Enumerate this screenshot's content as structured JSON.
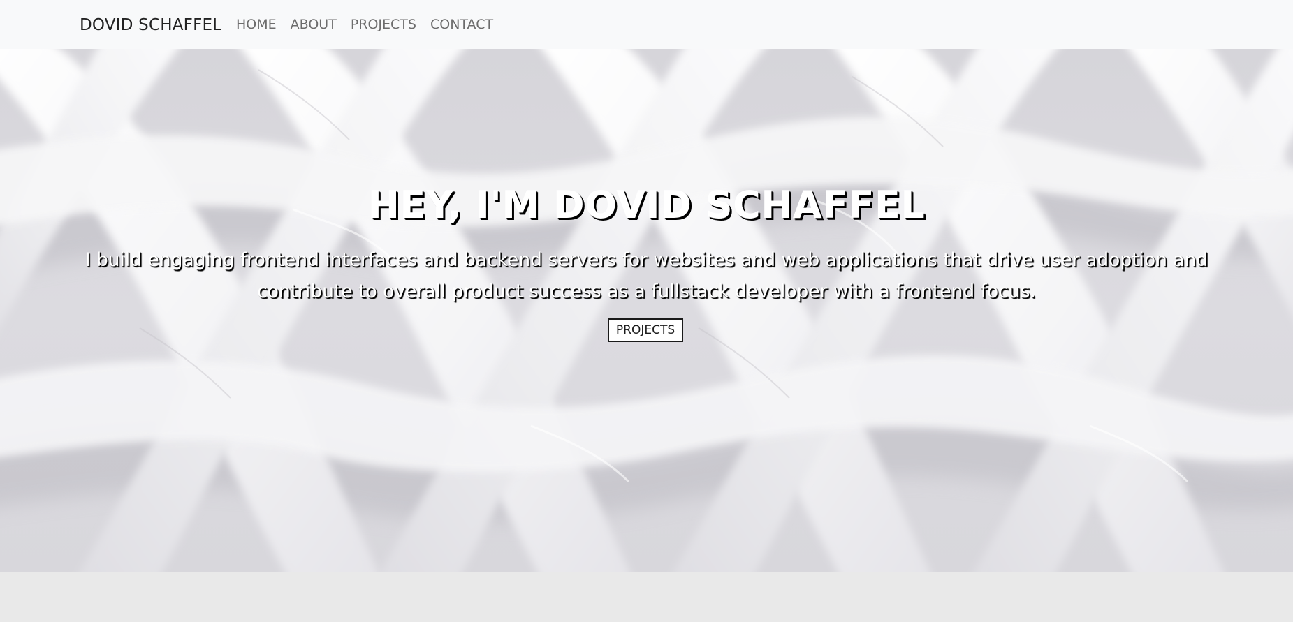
{
  "navbar": {
    "brand": "DOVID SCHAFFEL",
    "links": [
      {
        "label": "HOME"
      },
      {
        "label": "ABOUT"
      },
      {
        "label": "PROJECTS"
      },
      {
        "label": "CONTACT"
      }
    ]
  },
  "hero": {
    "title": "HEY, I'M DOVID SCHAFFEL",
    "subtitle": "I build engaging frontend interfaces and backend servers for websites and web applications that drive user adoption and contribute to overall product success as a fullstack developer with a frontend focus.",
    "button_label": "PROJECTS"
  },
  "colors": {
    "navbar_bg": "#f8f9fa",
    "hero_text": "#ffffff",
    "text_shadow": "#000000",
    "page_bg": "#e9e9e9"
  }
}
